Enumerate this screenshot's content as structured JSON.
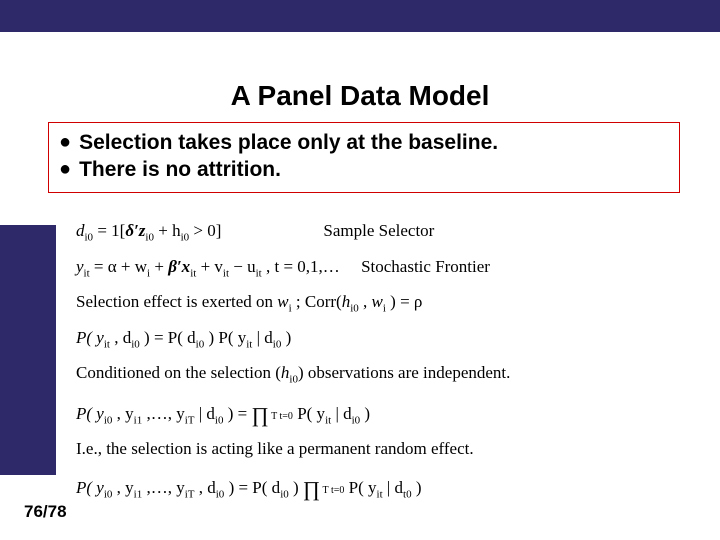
{
  "title": "A Panel Data Model",
  "bullets": {
    "b1": " Selection takes place only at the baseline.",
    "b2": "There is no attrition."
  },
  "math": {
    "l1_pre": "d",
    "l1_sub1": "i0",
    "l1_mid": " = 1[",
    "l1_bold": "δ′z",
    "l1_sub2": "i0",
    "l1_mid2": " + h",
    "l1_sub3": "i0",
    "l1_mid3": "  >  0]",
    "l1_label": "Sample Selector",
    "l2_pre": "y",
    "l2_sub1": "it",
    "l2_mid1": " = α + w",
    "l2_sub2": "i",
    "l2_mid2": " + ",
    "l2_bold": "β′x",
    "l2_sub3": "it",
    "l2_mid3": " + v",
    "l2_sub4": "it",
    "l2_mid4": " − u",
    "l2_sub5": "it",
    "l2_mid5": " ,   t = 0,1,…",
    "l2_label": "Stochastic Frontier",
    "l3_a": "Selection effect is exerted on ",
    "l3_w": "w",
    "l3_wi": "i",
    "l3_b": " ;   Corr(",
    "l3_h": "h",
    "l3_hi": "i0",
    "l3_c": " , ",
    "l3_w2": "w",
    "l3_wi2": "i",
    "l3_d": " ) = ρ",
    "l4_a": "P( y",
    "l4_s1": "it",
    "l4_b": " , d",
    "l4_s2": "i0",
    "l4_c": " ) = P( d",
    "l4_s3": "i0",
    "l4_d": " ) P( y",
    "l4_s4": "it",
    "l4_e": " | d",
    "l4_s5": "i0",
    "l4_f": " )",
    "l5_a": "Conditioned on the selection (",
    "l5_h": "h",
    "l5_hi": "i0",
    "l5_b": ") observations are independent.",
    "l6_a": "P( y",
    "l6_s1": "i0",
    "l6_b": " , y",
    "l6_s2": "i1",
    "l6_c": " ,…, y",
    "l6_s3": "iT",
    "l6_d": " | d",
    "l6_s4": "i0",
    "l6_e": " ) = ",
    "l6_prod": "∏",
    "l6_lim": "  T   t=0",
    "l6_f": "  P( y",
    "l6_s5": "it",
    "l6_g": " | d",
    "l6_s6": "i0",
    "l6_h": " )",
    "l7": "I.e., the selection is acting like a permanent random effect.",
    "l8_a": "P( y",
    "l8_s1": "i0",
    "l8_b": " , y",
    "l8_s2": "i1",
    "l8_c": " ,…, y",
    "l8_s3": "iT",
    "l8_d": " , d",
    "l8_s4": "i0",
    "l8_e": " ) = P( d",
    "l8_s5": "i0",
    "l8_f": " ) ",
    "l8_prod": "∏",
    "l8_g": "  P( y",
    "l8_s6": "it",
    "l8_h": " | d",
    "l8_s7": "t0",
    "l8_i": " )"
  },
  "page": "76/78"
}
